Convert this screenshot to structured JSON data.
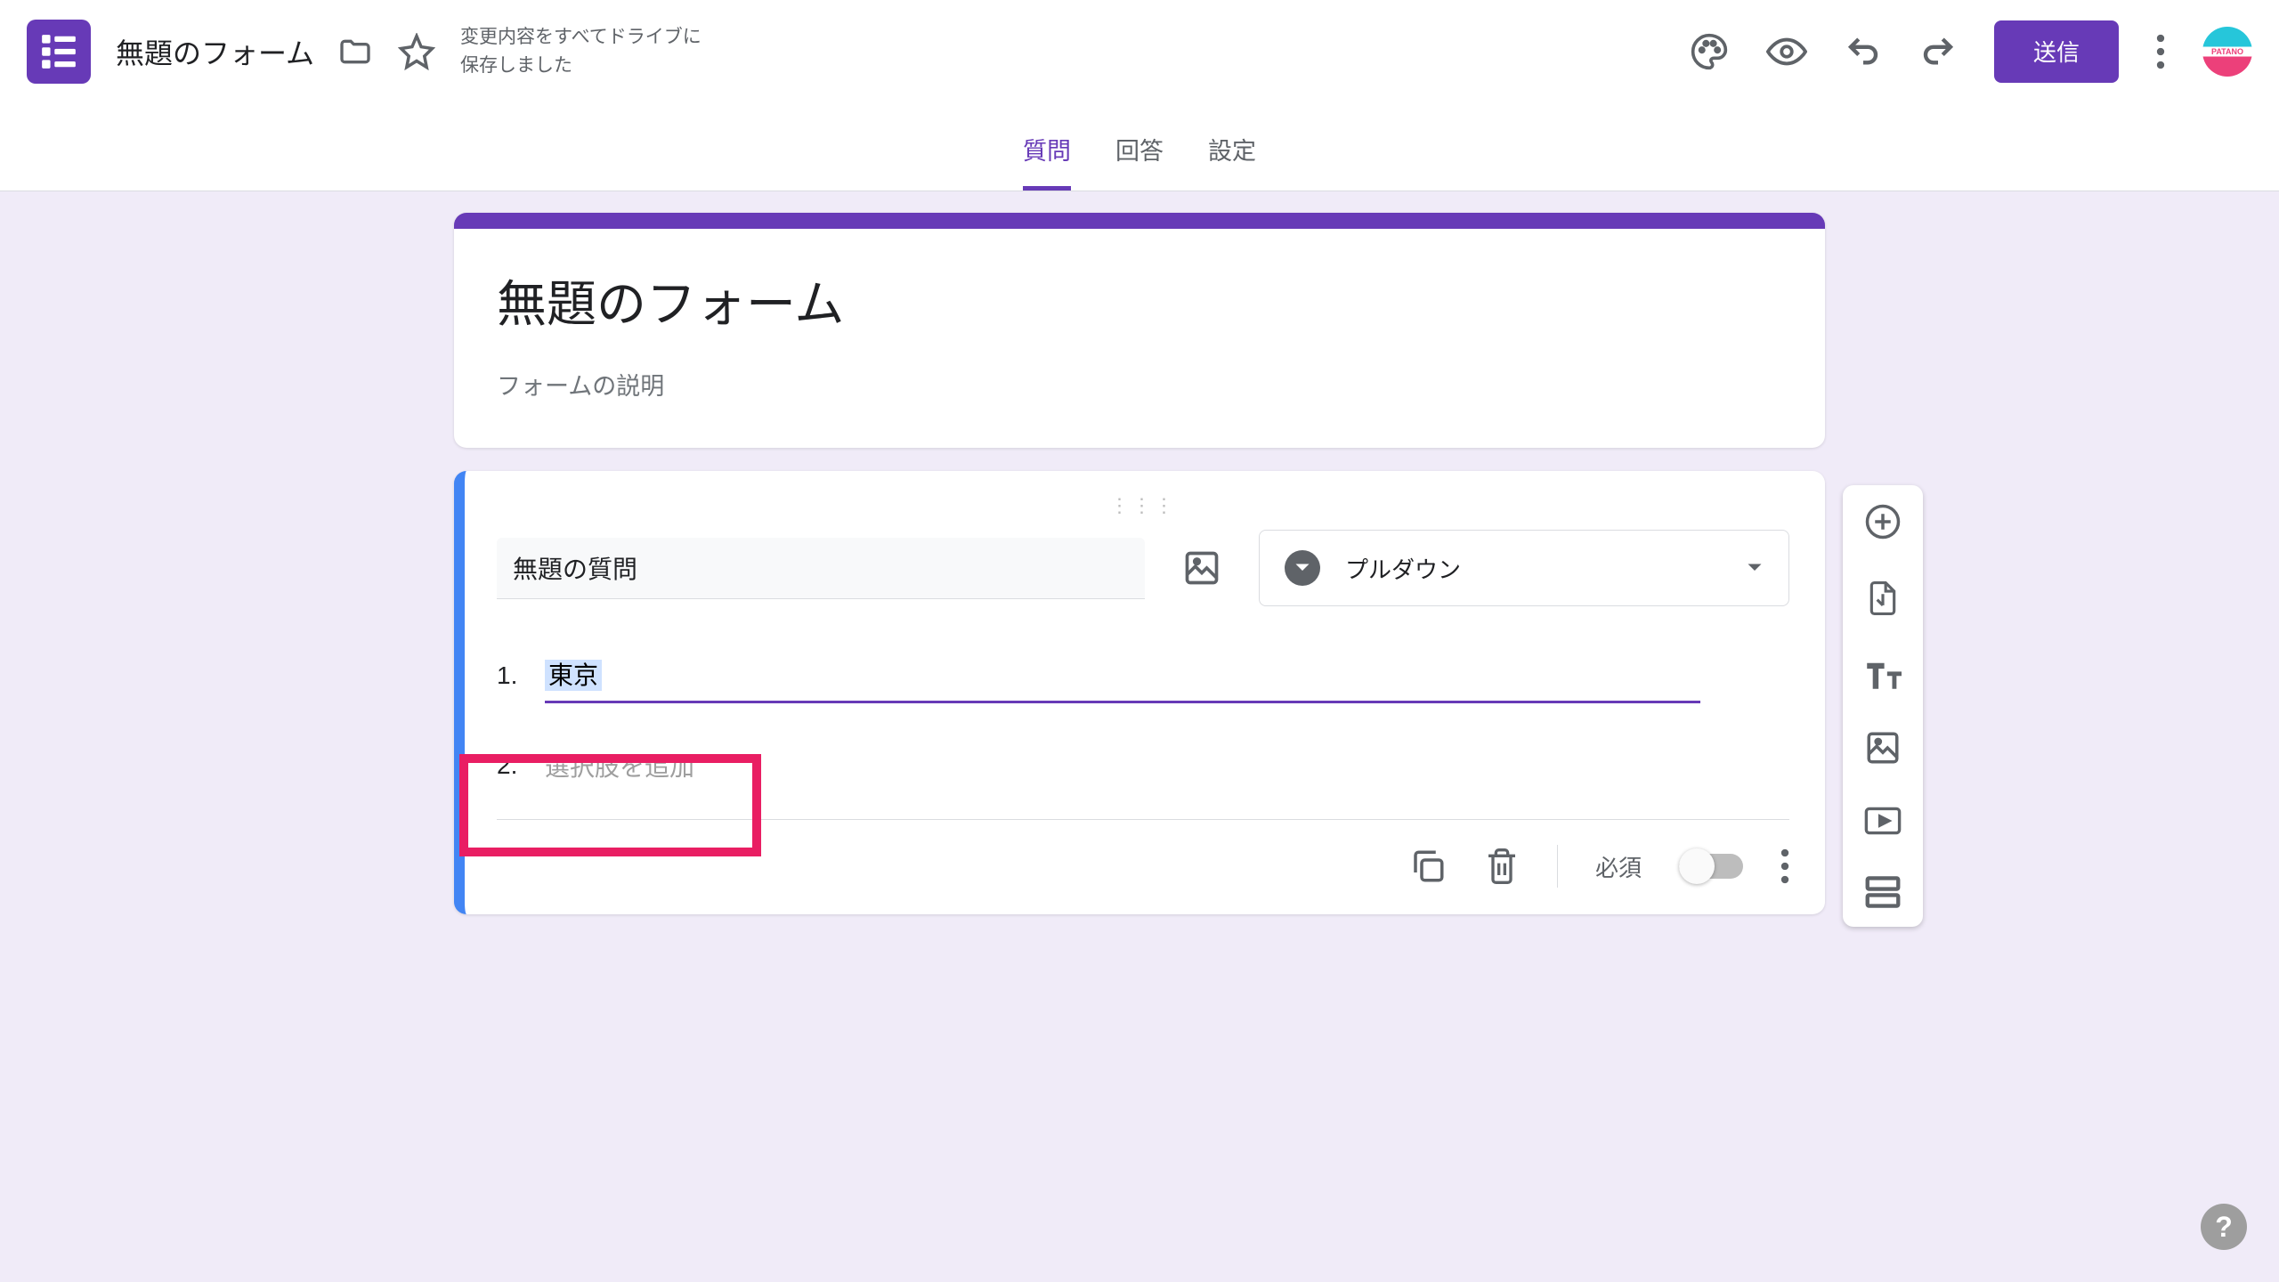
{
  "header": {
    "doc_title": "無題のフォーム",
    "save_status_line1": "変更内容をすべてドライブに",
    "save_status_line2": "保存しました",
    "send_label": "送信",
    "avatar_text": "PATANO"
  },
  "tabs": {
    "questions": "質問",
    "responses": "回答",
    "settings": "設定"
  },
  "form": {
    "title": "無題のフォーム",
    "description": "フォームの説明"
  },
  "question": {
    "title": "無題の質問",
    "type_label": "プルダウン",
    "options": [
      {
        "num": "1.",
        "value": "東京"
      },
      {
        "num": "2.",
        "placeholder": "選択肢を追加"
      }
    ],
    "required_label": "必須"
  },
  "help": "?"
}
